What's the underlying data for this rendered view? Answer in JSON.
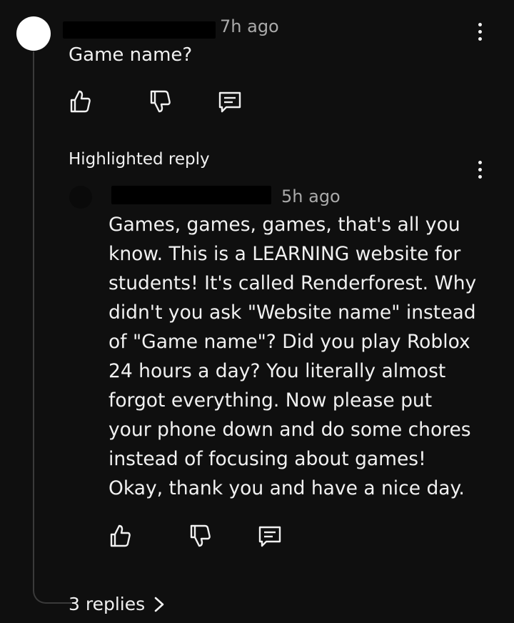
{
  "comment": {
    "author": "",
    "time": "7h ago",
    "text": "Game name?"
  },
  "reply": {
    "highlight_label": "Highlighted reply",
    "author": "",
    "time": "5h ago",
    "text": "Games, games, games, that's all you\nknow. This is a LEARNING website for\nstudents! It's called Renderforest. Why\ndidn't you ask \"Website name\" instead\nof \"Game name\"? Did you play Roblox\n24 hours a day? You literally almost\nforgot everything. Now please put\nyour phone down and do some chores\ninstead of focusing about games!\nOkay, thank you and have a nice day."
  },
  "thread": {
    "replies_label": "3 replies",
    "chevron": ">"
  },
  "icons": {
    "like": "thumbs-up-icon",
    "dislike": "thumbs-down-icon",
    "reply": "reply-comment-icon",
    "menu": "more-vertical-icon"
  },
  "colors": {
    "background": "#0f0f0f",
    "text": "#f1f1f1",
    "meta": "#aaaaaa"
  }
}
